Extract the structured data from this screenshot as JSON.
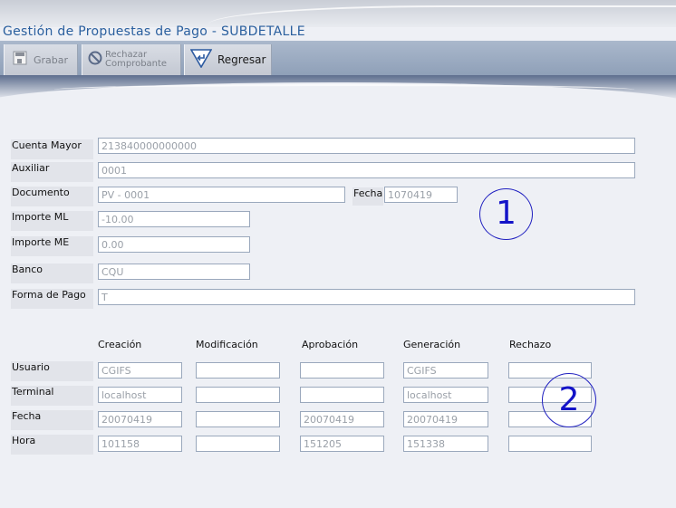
{
  "title": "Gestión de Propuestas de Pago - SUBDETALLE",
  "toolbar": {
    "grabar": "Grabar",
    "rechazar_line1": "Rechazar",
    "rechazar_line2": "Comprobante",
    "regresar": "Regresar"
  },
  "form": {
    "cuenta_mayor": {
      "label": "Cuenta Mayor",
      "value": "213840000000000"
    },
    "auxiliar": {
      "label": "Auxiliar",
      "value": "0001"
    },
    "documento": {
      "label": "Documento",
      "value": "PV - 0001"
    },
    "fecha": {
      "label": "Fecha",
      "value": "1070419"
    },
    "importe_ml": {
      "label": "Importe ML",
      "value": "-10.00"
    },
    "importe_me": {
      "label": "Importe ME",
      "value": "0.00"
    },
    "banco": {
      "label": "Banco",
      "value": "CQU"
    },
    "forma_pago": {
      "label": "Forma de Pago",
      "value": "T"
    }
  },
  "annotations": {
    "one": "1",
    "two": "2"
  },
  "audit": {
    "columns": [
      "Creación",
      "Modificación",
      "Aprobación",
      "Generación",
      "Rechazo"
    ],
    "rows": [
      {
        "label": "Usuario",
        "values": [
          "CGIFS",
          "",
          "",
          "CGIFS",
          ""
        ]
      },
      {
        "label": "Terminal",
        "values": [
          "localhost",
          "",
          "",
          "localhost",
          ""
        ]
      },
      {
        "label": "Fecha",
        "values": [
          "20070419",
          "",
          "20070419",
          "20070419",
          ""
        ]
      },
      {
        "label": "Hora",
        "values": [
          "101158",
          "",
          "151205",
          "151338",
          ""
        ]
      }
    ]
  }
}
